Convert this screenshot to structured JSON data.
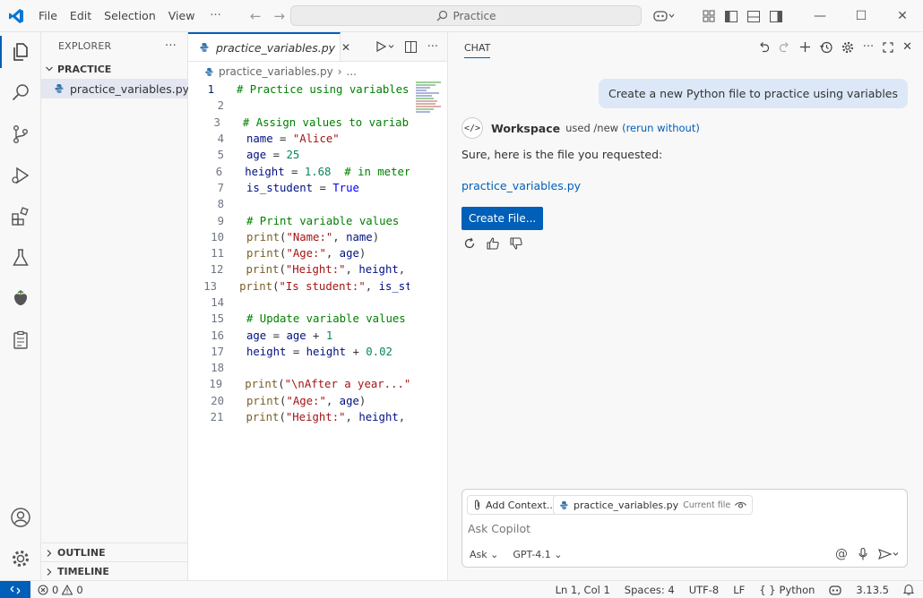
{
  "titlebar": {
    "menu": [
      "File",
      "Edit",
      "Selection",
      "View"
    ],
    "more": "···",
    "search_placeholder": "Practice"
  },
  "sidebar": {
    "title": "EXPLORER",
    "more": "···",
    "folder": "PRACTICE",
    "files": [
      "practice_variables.py"
    ],
    "outline": "OUTLINE",
    "timeline": "TIMELINE"
  },
  "editor": {
    "tab_label": "practice_variables.py",
    "breadcrumb_file": "practice_variables.py",
    "breadcrumb_more": "...",
    "lines": [
      {
        "n": "1",
        "tokens": [
          [
            "c-com",
            "# Practice using variables in Python"
          ]
        ]
      },
      {
        "n": "2",
        "tokens": []
      },
      {
        "n": "3",
        "tokens": [
          [
            "c-com",
            "# Assign values to variables"
          ]
        ]
      },
      {
        "n": "4",
        "tokens": [
          [
            "c-var",
            "name"
          ],
          [
            "c-pl",
            " = "
          ],
          [
            "c-str",
            "\"Alice\""
          ]
        ]
      },
      {
        "n": "5",
        "tokens": [
          [
            "c-var",
            "age"
          ],
          [
            "c-pl",
            " = "
          ],
          [
            "c-num",
            "25"
          ]
        ]
      },
      {
        "n": "6",
        "tokens": [
          [
            "c-var",
            "height"
          ],
          [
            "c-pl",
            " = "
          ],
          [
            "c-num",
            "1.68"
          ],
          [
            "c-pl",
            "  "
          ],
          [
            "c-com",
            "# in meters"
          ]
        ]
      },
      {
        "n": "7",
        "tokens": [
          [
            "c-var",
            "is_student"
          ],
          [
            "c-pl",
            " = "
          ],
          [
            "c-kw",
            "True"
          ]
        ]
      },
      {
        "n": "8",
        "tokens": []
      },
      {
        "n": "9",
        "tokens": [
          [
            "c-com",
            "# Print variable values"
          ]
        ]
      },
      {
        "n": "10",
        "tokens": [
          [
            "c-fn",
            "print"
          ],
          [
            "c-pl",
            "("
          ],
          [
            "c-str",
            "\"Name:\""
          ],
          [
            "c-pl",
            ", "
          ],
          [
            "c-var",
            "name"
          ],
          [
            "c-pl",
            ")"
          ]
        ]
      },
      {
        "n": "11",
        "tokens": [
          [
            "c-fn",
            "print"
          ],
          [
            "c-pl",
            "("
          ],
          [
            "c-str",
            "\"Age:\""
          ],
          [
            "c-pl",
            ", "
          ],
          [
            "c-var",
            "age"
          ],
          [
            "c-pl",
            ")"
          ]
        ]
      },
      {
        "n": "12",
        "tokens": [
          [
            "c-fn",
            "print"
          ],
          [
            "c-pl",
            "("
          ],
          [
            "c-str",
            "\"Height:\""
          ],
          [
            "c-pl",
            ", "
          ],
          [
            "c-var",
            "height"
          ],
          [
            "c-pl",
            ", "
          ]
        ]
      },
      {
        "n": "13",
        "tokens": [
          [
            "c-fn",
            "print"
          ],
          [
            "c-pl",
            "("
          ],
          [
            "c-str",
            "\"Is student:\""
          ],
          [
            "c-pl",
            ", "
          ],
          [
            "c-var",
            "is_student"
          ],
          [
            "c-pl",
            ")"
          ]
        ]
      },
      {
        "n": "14",
        "tokens": []
      },
      {
        "n": "15",
        "tokens": [
          [
            "c-com",
            "# Update variable values"
          ]
        ]
      },
      {
        "n": "16",
        "tokens": [
          [
            "c-var",
            "age"
          ],
          [
            "c-pl",
            " = "
          ],
          [
            "c-var",
            "age"
          ],
          [
            "c-pl",
            " + "
          ],
          [
            "c-num",
            "1"
          ]
        ]
      },
      {
        "n": "17",
        "tokens": [
          [
            "c-var",
            "height"
          ],
          [
            "c-pl",
            " = "
          ],
          [
            "c-var",
            "height"
          ],
          [
            "c-pl",
            " + "
          ],
          [
            "c-num",
            "0.02"
          ]
        ]
      },
      {
        "n": "18",
        "tokens": []
      },
      {
        "n": "19",
        "tokens": [
          [
            "c-fn",
            "print"
          ],
          [
            "c-pl",
            "("
          ],
          [
            "c-str",
            "\"\\nAfter a year...\""
          ],
          [
            "c-pl",
            ")"
          ]
        ]
      },
      {
        "n": "20",
        "tokens": [
          [
            "c-fn",
            "print"
          ],
          [
            "c-pl",
            "("
          ],
          [
            "c-str",
            "\"Age:\""
          ],
          [
            "c-pl",
            ", "
          ],
          [
            "c-var",
            "age"
          ],
          [
            "c-pl",
            ")"
          ]
        ]
      },
      {
        "n": "21",
        "tokens": [
          [
            "c-fn",
            "print"
          ],
          [
            "c-pl",
            "("
          ],
          [
            "c-str",
            "\"Height:\""
          ],
          [
            "c-pl",
            ", "
          ],
          [
            "c-var",
            "height"
          ],
          [
            "c-pl",
            ", "
          ]
        ]
      }
    ]
  },
  "chat": {
    "title": "CHAT",
    "user_message": "Create a new Python file to practice using variables",
    "agent_name": "Workspace",
    "agent_used": "used /new",
    "rerun": "(rerun without)",
    "response_text": "Sure, here is the file you requested:",
    "file_link": "practice_variables.py",
    "create_button": "Create File...",
    "add_context": "Add Context...",
    "context_file": "practice_variables.py",
    "context_file_sub": "Current file",
    "placeholder": "Ask Copilot",
    "mode": "Ask",
    "model": "GPT-4.1"
  },
  "statusbar": {
    "errors": "0",
    "warnings": "0",
    "position": "Ln 1, Col 1",
    "spaces": "Spaces: 4",
    "encoding": "UTF-8",
    "eol": "LF",
    "language": "Python",
    "version": "3.13.5"
  },
  "colors": {
    "accent": "#005fb8",
    "user_bubble": "#dce8f7",
    "comment": "#008000",
    "string": "#a31515",
    "number": "#098658"
  }
}
